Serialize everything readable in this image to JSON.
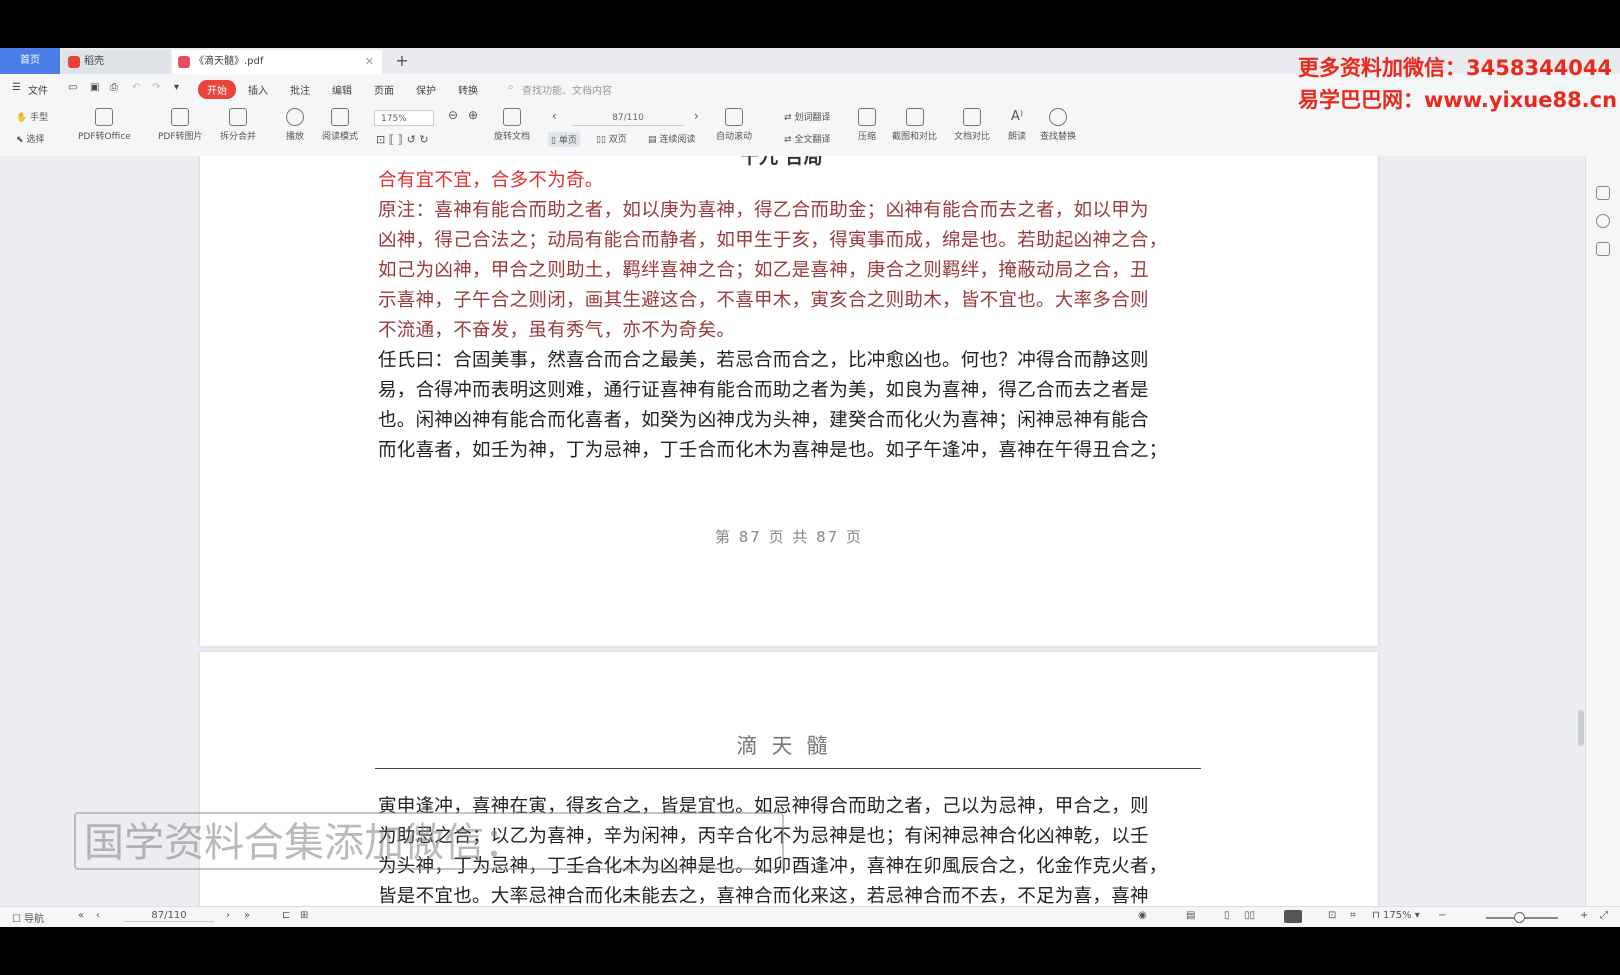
{
  "tabs": {
    "home": "首页",
    "store": "稻壳",
    "doc": "《滴天髓》.pdf",
    "add": "+"
  },
  "menu": {
    "file": "文件",
    "start": "开始",
    "insert": "插入",
    "comment": "批注",
    "edit": "编辑",
    "page": "页面",
    "protect": "保护",
    "convert": "转换",
    "search_placeholder": "查找功能、文档内容"
  },
  "ribbon": {
    "hand": "手型",
    "select": "选择",
    "pdf_to_office": "PDF转Office",
    "pdf_to_image": "PDF转图片",
    "split_merge": "拆分合并",
    "play": "播放",
    "read_mode": "阅读模式",
    "zoom": "175%",
    "page_field": "87/110",
    "rotate": "旋转文档",
    "single": "单页",
    "double": "双页",
    "continuous": "连续阅读",
    "auto_scroll": "自动滚动",
    "translate": "划词翻译",
    "full_translate": "全文翻译",
    "compress": "压缩",
    "screenshot_compare": "截图和对比",
    "doc_compare": "文档对比",
    "read_aloud": "朗读",
    "find_replace": "查找替换"
  },
  "overlay": {
    "ad_line1": "更多资料加微信：3458344044",
    "ad_line2": "易学巴巴网：www.yixue88.cn",
    "watermark": "国学资料合集添加微信："
  },
  "page1": {
    "heading_fragment": "十九 合局",
    "lines": [
      "合有宜不宜，合多不为奇。",
      "原注：喜神有能合而助之者，如以庚为喜神，得乙合而助金；凶神有能合而去之者，如以甲为",
      "凶神，得己合法之；动局有能合而静者，如甲生于亥，得寅事而成，绵是也。若助起凶神之合，",
      "如己为凶神，甲合之则助土，羁绊喜神之合；如乙是喜神，庚合之则羁绊，掩蔽动局之合，丑",
      "示喜神，子午合之则闭，画其生避这合，不喜甲木，寅亥合之则助木，皆不宜也。大率多合则",
      "不流通，不奋发，虽有秀气，亦不为奇矣。",
      "任氏曰：合固美事，然喜合而合之最美，若忌合而合之，比冲愈凶也。何也？冲得合而静这则",
      "易，合得冲而表明这则难，通行证喜神有能合而助之者为美，如良为喜神，得乙合而去之者是",
      "也。闲神凶神有能合而化喜者，如癸为凶神戊为头神，建癸合而化火为喜神；闲神忌神有能合",
      "而化喜者，如壬为神，丁为忌神，丁壬合而化木为喜神是也。如子午逢冲，喜神在午得丑合之；"
    ],
    "page_number": "第 87 页 共 87 页"
  },
  "page2": {
    "header": "滴天髓",
    "lines": [
      "寅申逢冲，喜神在寅，得亥合之，皆是宜也。如忌神得合而助之者，己以为忌神，甲合之，则",
      "为助忌之合；以乙为喜神，辛为闲神，丙辛合化不为忌神是也；有闲神忌神合化凶神乾，以壬",
      "为头神，丁为忌神，丁壬合化木为凶神是也。如卯酉逢冲，喜神在卯風辰合之，化金作克火者，",
      "皆是不宜也。大率忌神合而化未能去之，喜神合而化来这，若忌神合而不去，不足为喜，喜神"
    ]
  },
  "statusbar": {
    "nav": "导航",
    "page_field": "87/110",
    "zoom": "175%"
  }
}
